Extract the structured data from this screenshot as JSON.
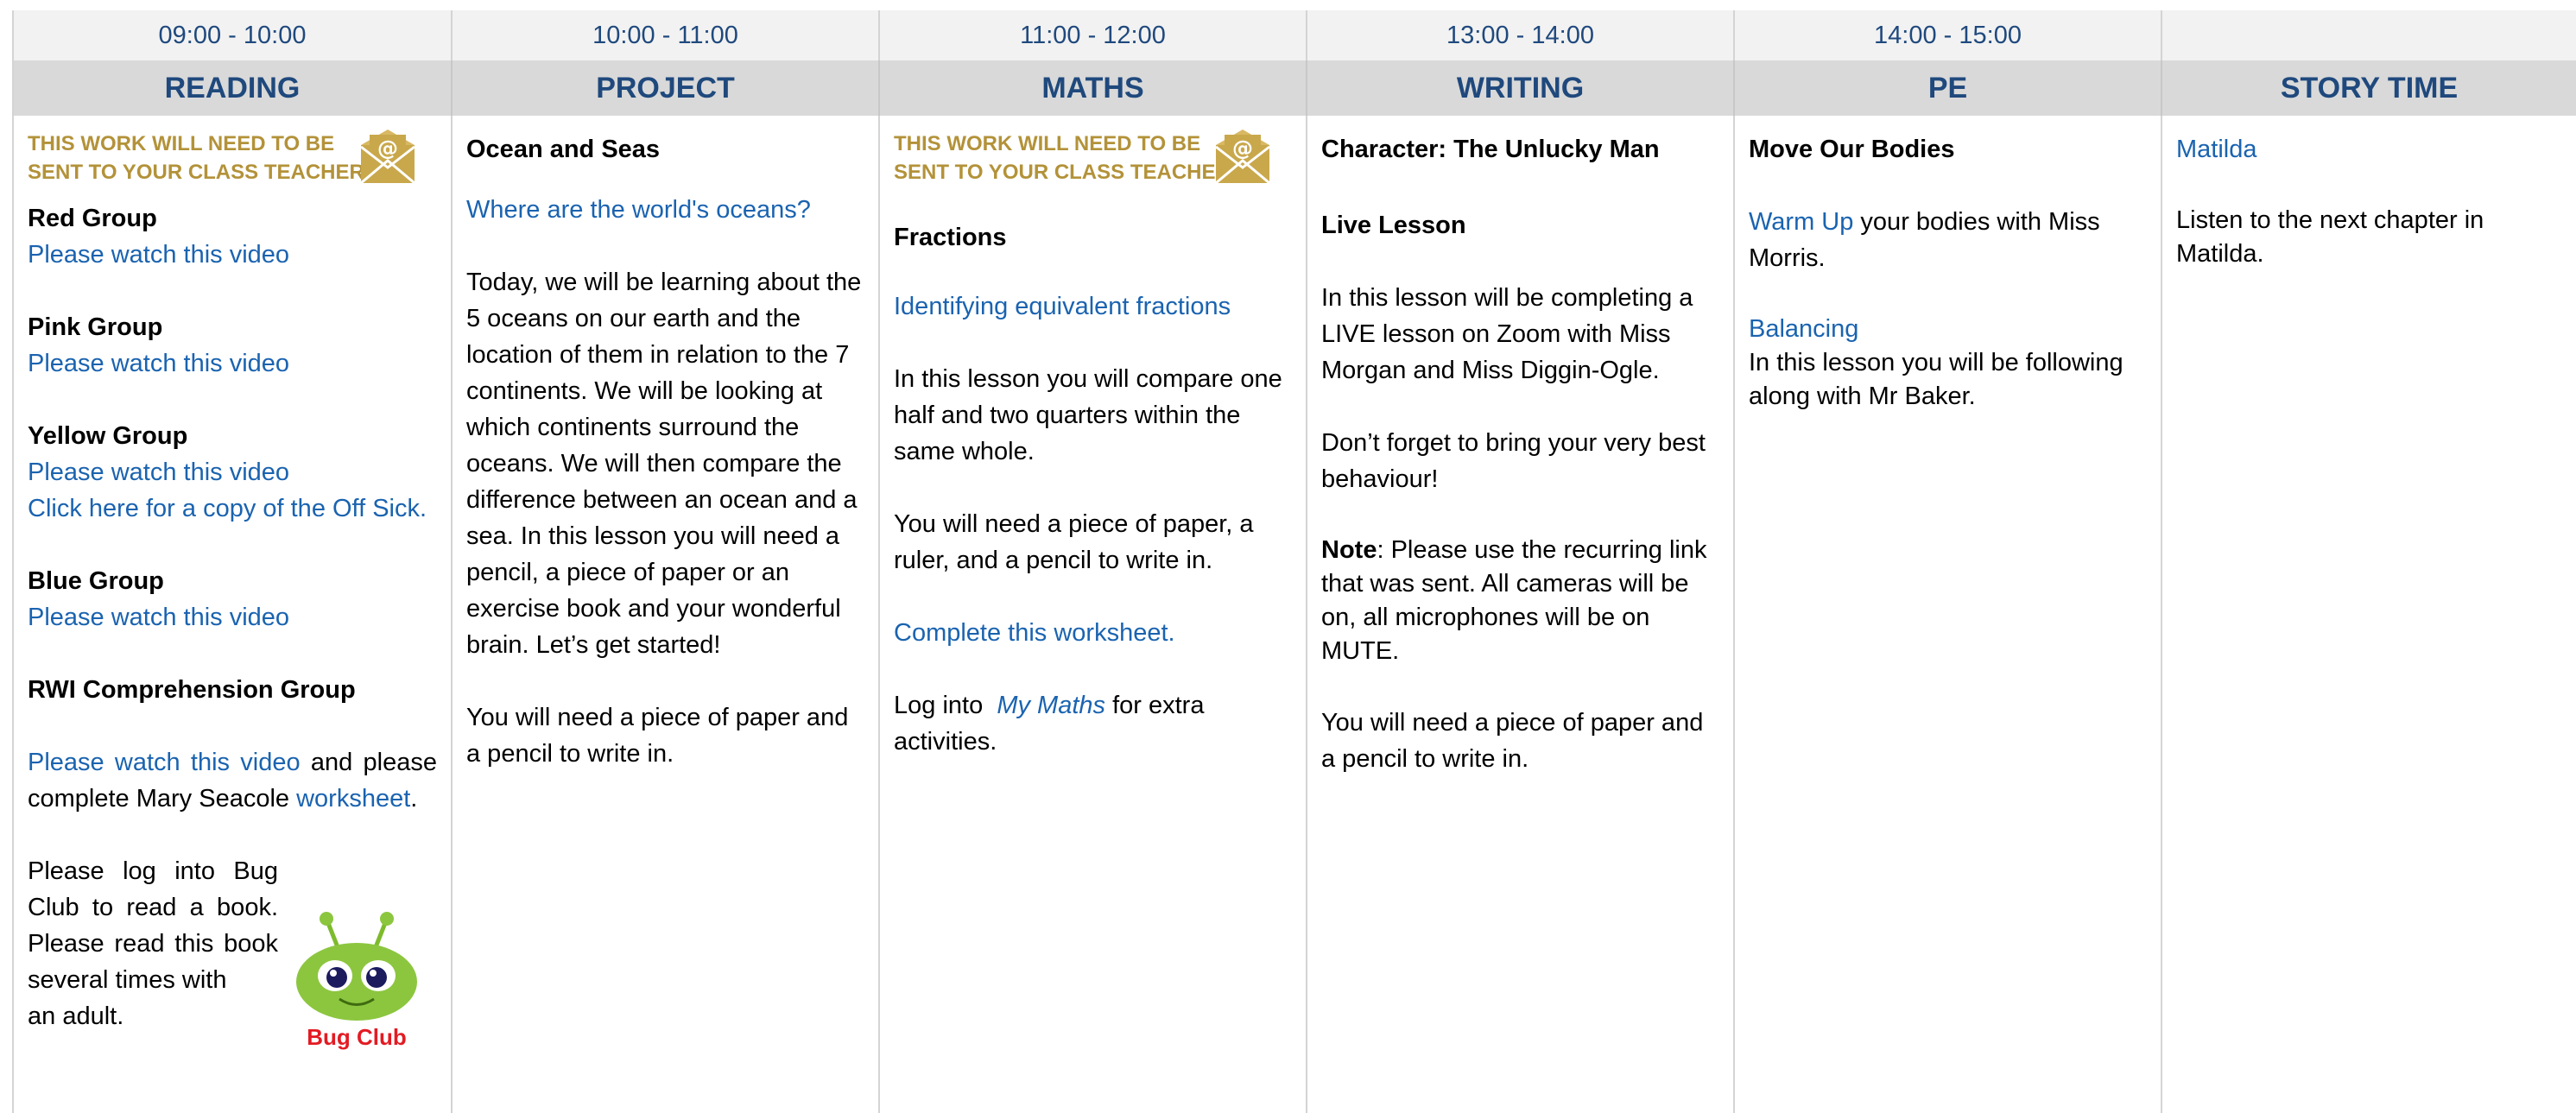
{
  "times": [
    "09:00 - 10:00",
    "10:00 - 11:00",
    "11:00 - 12:00",
    "13:00 - 14:00",
    "14:00 - 15:00",
    ""
  ],
  "subjects": [
    "READING",
    "PROJECT",
    "MATHS",
    "WRITING",
    "PE",
    "STORY TIME"
  ],
  "notice": {
    "line1": "THIS WORK WILL NEED TO BE",
    "line2": "SENT TO YOUR CLASS TEACHER"
  },
  "reading": {
    "red": "Red Group",
    "red_link": "Please watch this video",
    "pink": "Pink Group",
    "pink_link": "Please watch this video",
    "yellow": "Yellow Group",
    "yellow_link": "Please watch this video",
    "yellow_link2": "Click here for a copy of the Off Sick.",
    "blue": "Blue Group",
    "blue_link": "Please watch this video",
    "rwi": "RWI Comprehension Group",
    "rwi_link": "Please watch this video",
    "rwi_text1": " and please complete Mary Seacole ",
    "rwi_link2": "worksheet",
    "rwi_text2": ".",
    "bug_line1": "Please log into Bug",
    "bug_line2": "Club to read a book.",
    "bug_line3": "Please read this book",
    "bug_line4": "several times with",
    "bug_line5": "an adult.",
    "bug_logo": "Bug Club"
  },
  "project": {
    "title": "Ocean and Seas",
    "link": "Where are the world's oceans?",
    "para": "Today, we will be learning about the 5 oceans on our earth and the location of them in relation to the 7 continents. We will be looking at which continents surround the oceans. We will then compare the difference between an ocean and a sea. In this lesson you will need a pencil, a piece of paper or an exercise book and your wonderful brain. Let’s get started!",
    "para2": "You will need a piece of paper and a pencil to write in."
  },
  "maths": {
    "title": "Fractions",
    "link": "Identifying equivalent fractions",
    "para": "In this lesson you will compare one half and two quarters within the same whole.",
    "para2": "You will need a piece of paper, a ruler, and a pencil to write in.",
    "link2": "Complete this worksheet.",
    "login_pre": "Log into  ",
    "login_link": "My Maths",
    "login_post": " for extra activities."
  },
  "writing": {
    "title": "Character: The Unlucky Man",
    "sub": "Live Lesson",
    "para": "In this lesson will be completing a LIVE lesson on Zoom with Miss Morgan and Miss Diggin-Ogle.",
    "para2": "Don’t forget to bring your very best behaviour!",
    "note_label": "Note",
    "note_text": ": Please use the recurring link that was sent. All cameras will be on, all microphones will be on MUTE.",
    "para3": "You will need a piece of paper and a pencil to write in."
  },
  "pe": {
    "title": "Move Our Bodies",
    "warm_link": "Warm Up",
    "warm_text": " your bodies with Miss Morris.",
    "bal_link": "Balancing",
    "bal_text": "In this lesson you will be following along with Mr Baker."
  },
  "story": {
    "link": "Matilda",
    "text": "Listen to the next chapter in Matilda."
  },
  "colors": {
    "heading": "#1f497d",
    "link": "#1a63b0",
    "notice": "#b39239",
    "header_bg": "#d9d9d9"
  }
}
